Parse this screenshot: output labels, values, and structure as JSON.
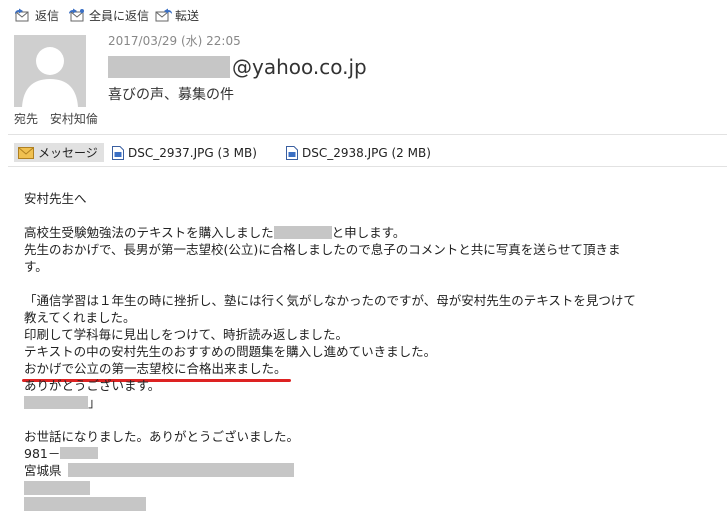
{
  "toolbar": {
    "reply": "返信",
    "reply_all": "全員に返信",
    "forward": "転送"
  },
  "header": {
    "date": "2017/03/29 (水) 22:05",
    "sender_domain": "@yahoo.co.jp",
    "subject": "喜びの声、募集の件",
    "to_label": "宛先",
    "to_value": "安村知倫"
  },
  "attachments": {
    "message_tab": "メッセージ",
    "files": [
      "DSC_2937.JPG (3 MB)",
      "DSC_2938.JPG (2 MB)"
    ]
  },
  "body": {
    "greeting": "安村先生へ",
    "intro_a": "高校生受験勉強法のテキストを購入しました",
    "intro_b": "と申します。",
    "line2": "先生のおかげで、長男が第一志望校(公立)に合格しましたので息子のコメントと共に写真を送らせて頂きま",
    "line3": "す。",
    "quote1": "「通信学習は１年生の時に挫折し、塾には行く気がしなかったのですが、母が安村先生のテキストを見つけて",
    "quote2": "教えてくれました。",
    "quote3": "印刷して学科毎に見出しをつけて、時折読み返しました。",
    "quote4": "テキストの中の安村先生のおすすめの問題集を購入し進めていきました。",
    "quote5": "おかげで公立の第一志望校に合格出来ました。",
    "quote6": "ありがとうございます。",
    "quote_end": "」",
    "closing": "お世話になりました。ありがとうございました。",
    "zip": "981－",
    "pref": "宮城県"
  },
  "colors": {
    "underline": "#d22222",
    "redaction": "#c6c6c6",
    "avatar": "#cfcfcf"
  }
}
